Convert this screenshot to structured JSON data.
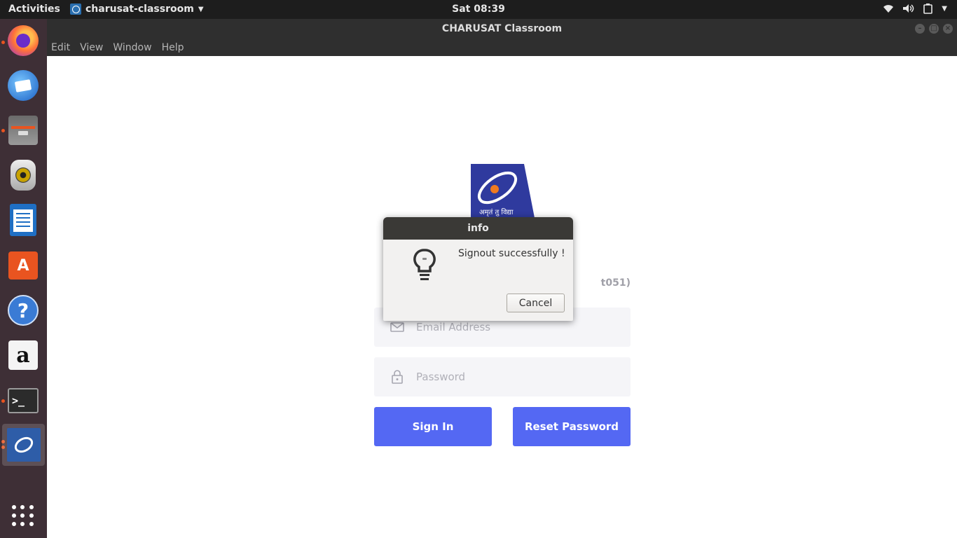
{
  "topbar": {
    "activities": "Activities",
    "app_name": "charusat-classroom",
    "clock": "Sat 08:39"
  },
  "window": {
    "title": "CHARUSAT Classroom",
    "menu": [
      "Edit",
      "View",
      "Window",
      "Help"
    ]
  },
  "dock": {
    "items": [
      {
        "name": "firefox-icon",
        "running": true
      },
      {
        "name": "thunderbird-icon",
        "running": false
      },
      {
        "name": "files-icon",
        "running": true
      },
      {
        "name": "rhythmbox-icon",
        "running": false
      },
      {
        "name": "libreoffice-writer-icon",
        "running": false
      },
      {
        "name": "software-center-icon",
        "running": false
      },
      {
        "name": "help-icon",
        "running": false
      },
      {
        "name": "amazon-icon",
        "running": false
      },
      {
        "name": "terminal-icon",
        "running": true
      },
      {
        "name": "charusat-classroom-icon",
        "running": true,
        "active": true
      },
      {
        "name": "show-applications-icon",
        "running": false
      }
    ],
    "store_glyph": "A",
    "help_glyph": "?",
    "amazon_glyph": "a",
    "terminal_glyph": ">_"
  },
  "login": {
    "logo_text": "अमृतं तु विद्या",
    "subtitle_fragment": "t051)",
    "email_placeholder": "Email Address",
    "password_placeholder": "Password",
    "sign_in": "Sign In",
    "reset_password": "Reset Password"
  },
  "dialog": {
    "title": "info",
    "message": "Signout successfully !",
    "cancel": "Cancel"
  },
  "colors": {
    "primary_button": "#5468f3",
    "dock_bg": "#3e2f36",
    "running_dot": "#e95420",
    "dialog_title_bg": "#3a3936"
  }
}
